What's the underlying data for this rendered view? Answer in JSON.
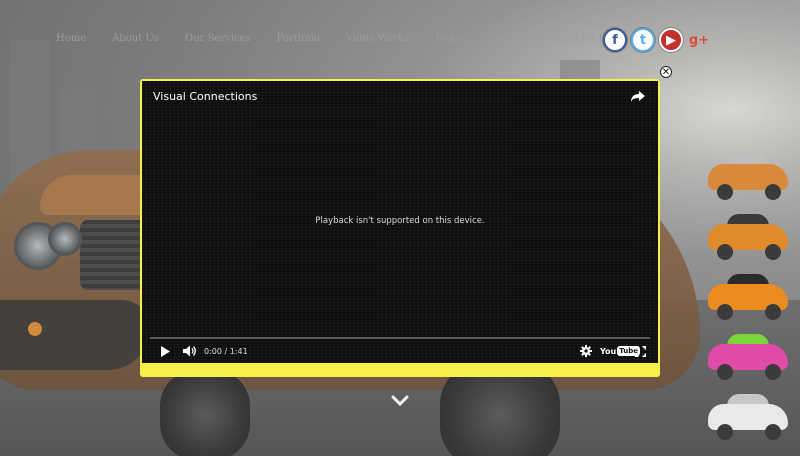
{
  "nav": {
    "items": [
      "Home",
      "About Us",
      "Our Services",
      "Portfolio",
      "Video Works",
      "Blogs",
      "Careers",
      "Contact Us"
    ]
  },
  "social": [
    {
      "name": "facebook-icon",
      "glyph": "f"
    },
    {
      "name": "twitter-icon",
      "glyph": "t"
    },
    {
      "name": "youtube-icon",
      "glyph": "▶"
    },
    {
      "name": "google-plus-icon",
      "glyph": "g+"
    }
  ],
  "close": {
    "glyph": "✕"
  },
  "video": {
    "title": "Visual Connections",
    "message": "Playback isn't supported on this device.",
    "time": "0:00 / 1:41",
    "youtube_you": "You",
    "youtube_tube": "Tube"
  },
  "thumbnails": [
    {
      "name": "thumbnail-wireframe-car",
      "body": "#d9893a",
      "roof": "#bfbfbf"
    },
    {
      "name": "thumbnail-orange-car-1",
      "body": "#e08a2c",
      "roof": "#3a3a3a"
    },
    {
      "name": "thumbnail-orange-car-2",
      "body": "#ee8b1f",
      "roof": "#2b2b2b"
    },
    {
      "name": "thumbnail-pink-green-car",
      "body": "#e04aa8",
      "roof": "#7bd63c"
    },
    {
      "name": "thumbnail-white-car",
      "body": "#e9e9e9",
      "roof": "#c7c7c7"
    }
  ],
  "colors": {
    "modal_border": "#f7f04a",
    "player_bg": "#0d0d0d"
  }
}
